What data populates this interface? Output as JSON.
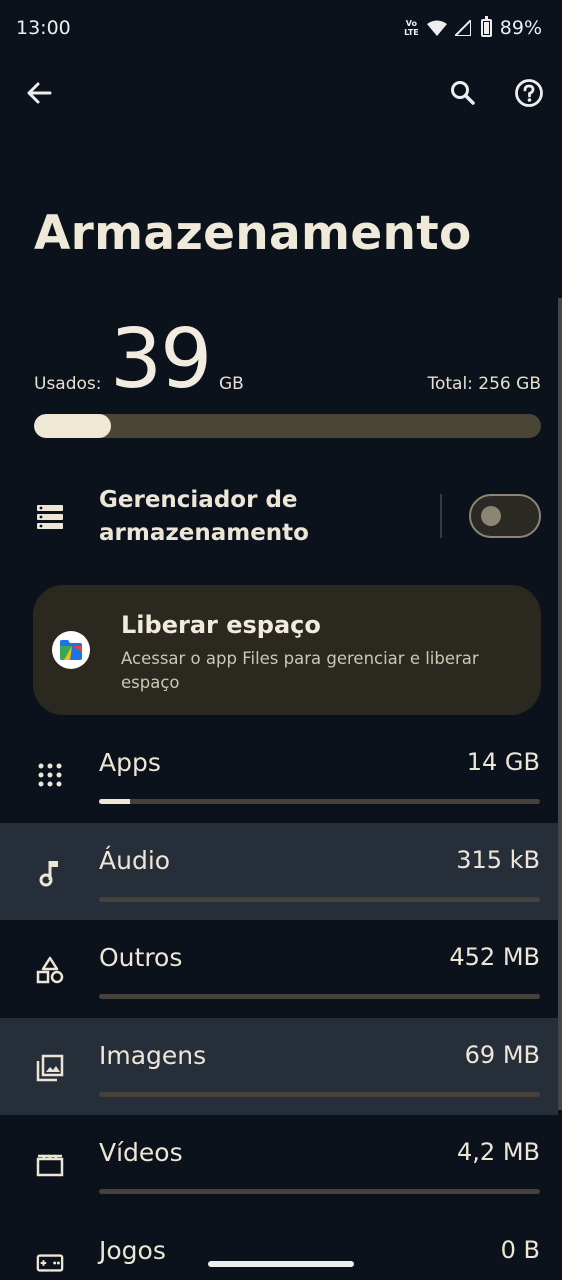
{
  "status_bar": {
    "time": "13:00",
    "volte_line1": "Vo",
    "volte_line2": "LTE",
    "battery_percent": "89%",
    "battery_level": 0.89,
    "icons": [
      "volte-icon",
      "wifi-icon",
      "signal-icon",
      "battery-icon"
    ]
  },
  "app_bar": {
    "back_icon": "arrow-left-icon",
    "search_icon": "search-icon",
    "help_icon": "help-circle-icon"
  },
  "title": "Armazenamento",
  "usage": {
    "used_label": "Usados:",
    "used_value": "39",
    "used_unit": "GB",
    "total_label": "Total: 256 GB",
    "used_fraction": 0.1523
  },
  "manager": {
    "label": "Gerenciador de armazenamento",
    "enabled": false,
    "icon": "storage-list-icon"
  },
  "free_space": {
    "title": "Liberar espaço",
    "description": "Acessar o app Files para gerenciar e liberar espaço",
    "icon": "files-app-icon"
  },
  "categories": [
    {
      "label": "Apps",
      "size": "14 GB",
      "icon": "apps-grid-icon",
      "fraction": 0.07,
      "highlight": false
    },
    {
      "label": "Áudio",
      "size": "315 kB",
      "icon": "music-note-icon",
      "fraction": 0.0,
      "highlight": true
    },
    {
      "label": "Outros",
      "size": "452 MB",
      "icon": "shapes-icon",
      "fraction": 0.0,
      "highlight": false
    },
    {
      "label": "Imagens",
      "size": "69 MB",
      "icon": "image-icon",
      "fraction": 0.0,
      "highlight": true
    },
    {
      "label": "Vídeos",
      "size": "4,2 MB",
      "icon": "video-icon",
      "fraction": 0.0,
      "highlight": false
    },
    {
      "label": "Jogos",
      "size": "0 B",
      "icon": "gamepad-icon",
      "fraction": 0.0,
      "highlight": false
    }
  ],
  "colors": {
    "background": "#0b121c",
    "accent": "#efe8d4",
    "track": "#4b4535",
    "card": "#2b281f",
    "highlight": "#262e39"
  }
}
